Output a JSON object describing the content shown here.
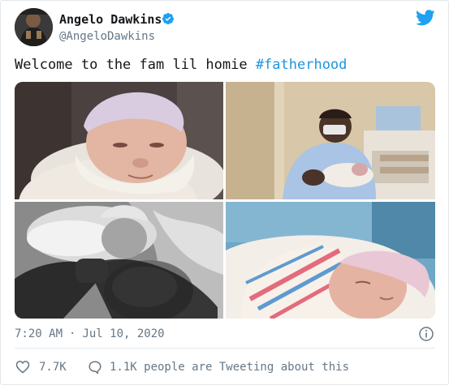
{
  "author": {
    "name": "Angelo Dawkins",
    "handle": "@AngeloDawkins"
  },
  "tweet": {
    "text": "Welcome to the fam lil homie ",
    "hashtag": "#fatherhood"
  },
  "media": {
    "count": 4
  },
  "meta": {
    "time": "7:20 AM",
    "separator": "·",
    "date": "Jul 10, 2020"
  },
  "actions": {
    "likes": "7.7K",
    "replies_text": "1.1K people are Tweeting about this"
  },
  "colors": {
    "brand_blue": "#1da1f2",
    "hashtag": "#1b95e0",
    "muted": "#657786",
    "like_red": "#e0245e"
  },
  "icons": {
    "verified": "verified-badge-icon",
    "logo": "twitter-bird-icon",
    "info": "info-icon",
    "like": "heart-icon",
    "reply": "speech-bubble-icon"
  }
}
